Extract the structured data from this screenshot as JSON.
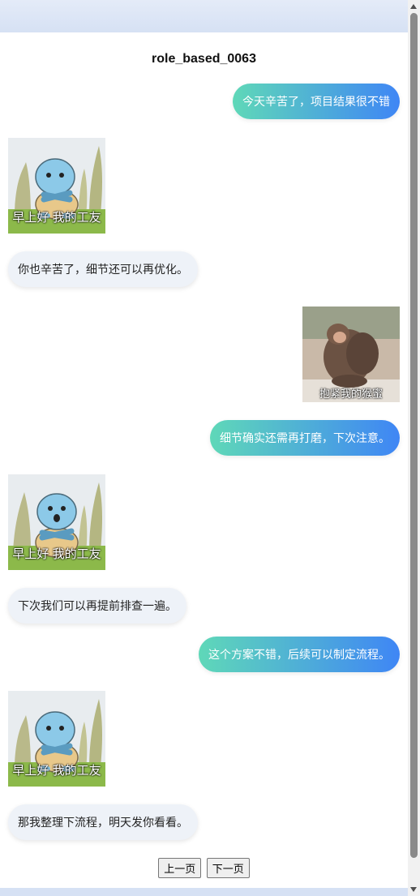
{
  "title": "role_based_0063",
  "messages": [
    {
      "side": "right",
      "type": "text",
      "text": "今天辛苦了，项目结果很不错"
    },
    {
      "side": "left",
      "type": "sticker",
      "sticker": "squirtle-arms-crossed",
      "caption": "早上好 我的工友"
    },
    {
      "side": "left",
      "type": "text",
      "text": "你也辛苦了，细节还可以再优化。"
    },
    {
      "side": "right",
      "type": "sticker",
      "sticker": "monkeys-hugging",
      "caption": "抱紧我的猴蜜"
    },
    {
      "side": "right",
      "type": "text",
      "text": "细节确实还需再打磨，下次注意。"
    },
    {
      "side": "left",
      "type": "sticker",
      "sticker": "squirtle-surprised",
      "caption": "早上好 我的工友"
    },
    {
      "side": "left",
      "type": "text",
      "text": "下次我们可以再提前排查一遍。"
    },
    {
      "side": "right",
      "type": "text",
      "text": "这个方案不错，后续可以制定流程。"
    },
    {
      "side": "left",
      "type": "sticker",
      "sticker": "squirtle-arms-crossed",
      "caption": "早上好 我的工友"
    },
    {
      "side": "left",
      "type": "text",
      "text": "那我整理下流程，明天发你看看。"
    }
  ],
  "pagination": {
    "prev_label": "上一页",
    "next_label": "下一页"
  },
  "colors": {
    "user_bubble_start": "#5fd8b8",
    "user_bubble_end": "#3f86f5",
    "other_bubble": "#eef2f8"
  }
}
